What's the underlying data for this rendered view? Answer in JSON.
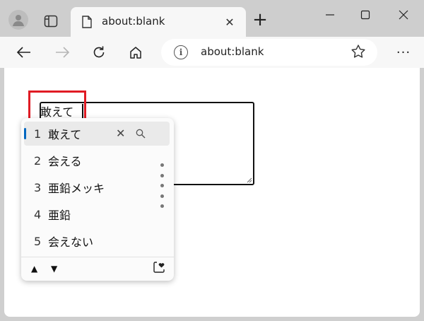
{
  "browser": {
    "tab_title": "about:blank",
    "address_url": "about:blank",
    "new_tab_symbol": "+",
    "tab_close_symbol": "✕",
    "more_symbol": "···"
  },
  "editor": {
    "composing_text": "敢えて"
  },
  "ime": {
    "candidates": [
      {
        "num": "1",
        "text": "敢えて"
      },
      {
        "num": "2",
        "text": "会える"
      },
      {
        "num": "3",
        "text": "亜鉛メッキ"
      },
      {
        "num": "4",
        "text": "亜鉛"
      },
      {
        "num": "5",
        "text": "会えない"
      }
    ],
    "selected_index": 0,
    "remove_symbol": "✕",
    "prev_symbol": "▲",
    "next_symbol": "▼"
  },
  "colors": {
    "highlight": "#e01b24",
    "accent": "#0067c0"
  },
  "icons": [
    "profile-icon",
    "tab-actions-icon",
    "page-icon",
    "back-icon",
    "forward-icon",
    "refresh-icon",
    "home-icon",
    "info-icon",
    "favorite-star-icon",
    "search-icon",
    "favorite-add-icon"
  ]
}
